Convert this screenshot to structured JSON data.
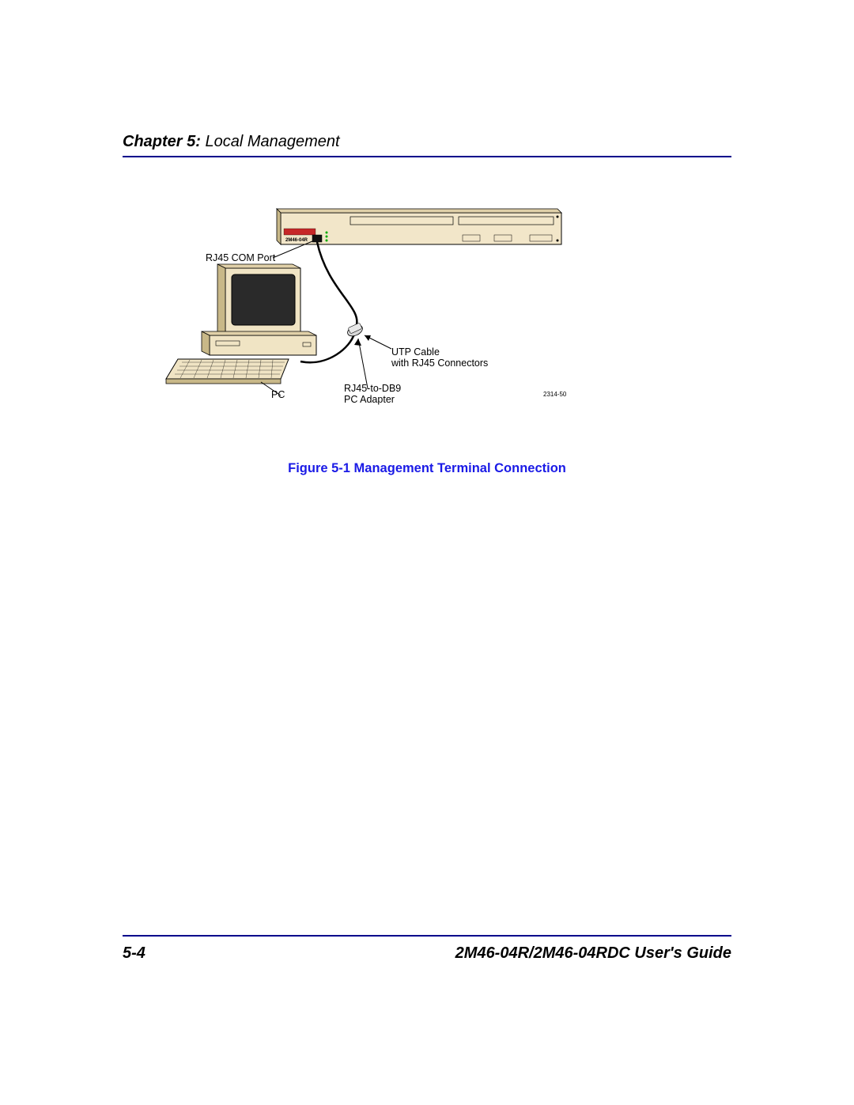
{
  "header": {
    "chapter_label": "Chapter 5:",
    "chapter_title": " Local Management"
  },
  "figure": {
    "labels": {
      "rj45_com_port": "RJ45 COM Port",
      "pc": "PC",
      "adapter_line1": "RJ45-to-DB9",
      "adapter_line2": "PC Adapter",
      "utp_line1": "UTP Cable",
      "utp_line2": "with RJ45 Connectors",
      "device_model": "2M46-04R",
      "diag_number": "2314-50"
    },
    "caption": "Figure 5-1    Management Terminal Connection"
  },
  "footer": {
    "page_number": "5-4",
    "guide_title": "2M46-04R/2M46-04RDC User's Guide"
  }
}
